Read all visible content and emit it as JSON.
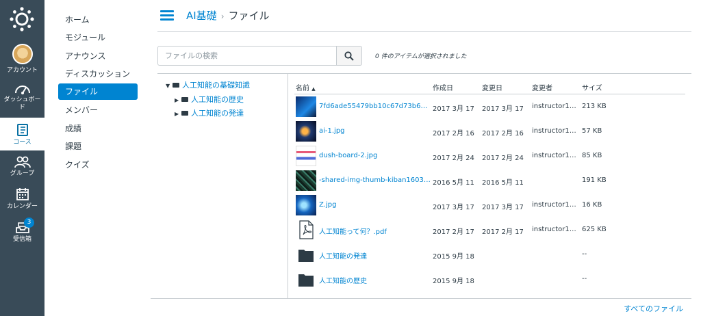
{
  "global_nav": {
    "account": "アカウント",
    "dashboard": "ダッシュボード",
    "courses": "コース",
    "groups": "グループ",
    "calendar": "カレンダー",
    "inbox": "受信箱",
    "inbox_badge": "3"
  },
  "course_nav": {
    "items": [
      "ホーム",
      "モジュール",
      "アナウンス",
      "ディスカッション",
      "ファイル",
      "メンバー",
      "成績",
      "課題",
      "クイズ"
    ],
    "active_index": 4
  },
  "breadcrumb": {
    "course": "AI基礎",
    "page": "ファイル"
  },
  "search": {
    "placeholder": "ファイルの検索"
  },
  "selection_info": "0 件のアイテムが選択されました",
  "tree": {
    "root": "人工知能の基礎知識",
    "children": [
      "人工知能の歴史",
      "人工知能の発達"
    ]
  },
  "table": {
    "headers": {
      "name": "名前",
      "created": "作成日",
      "modified": "変更日",
      "modifier": "変更者",
      "size": "サイズ"
    },
    "rows": [
      {
        "name": "7fd6ade55479bb10c67d73b64c1...",
        "created": "2017 3月 17",
        "modified": "2017 3月 17",
        "modifier": "instructor1@b...",
        "size": "213 KB",
        "icon": "image-thumbnail"
      },
      {
        "name": "ai-1.jpg",
        "created": "2017 2月 16",
        "modified": "2017 2月 16",
        "modifier": "instructor1@b...",
        "size": "57 KB",
        "icon": "image-thumbnail"
      },
      {
        "name": "dush-board-2.jpg",
        "created": "2017 2月 24",
        "modified": "2017 2月 24",
        "modifier": "instructor1@b...",
        "size": "85 KB",
        "icon": "image-thumbnail"
      },
      {
        "name": "-shared-img-thumb-kiban1603093...",
        "created": "2016 5月 11",
        "modified": "2016 5月 11",
        "modifier": "",
        "size": "191 KB",
        "icon": "image-thumbnail"
      },
      {
        "name": "Z.jpg",
        "created": "2017 3月 17",
        "modified": "2017 3月 17",
        "modifier": "instructor1@b...",
        "size": "16 KB",
        "icon": "image-thumbnail"
      },
      {
        "name": "人工知能って何？.pdf",
        "created": "2017 2月 17",
        "modified": "2017 2月 17",
        "modifier": "instructor1@b...",
        "size": "625 KB",
        "icon": "pdf-icon"
      },
      {
        "name": "人工知能の発達",
        "created": "2015 9月 18",
        "modified": "",
        "modifier": "",
        "size": "--",
        "icon": "folder-icon"
      },
      {
        "name": "人工知能の歴史",
        "created": "2015 9月 18",
        "modified": "",
        "modifier": "",
        "size": "--",
        "icon": "folder-icon"
      }
    ]
  },
  "footer_link": "すべてのファイル",
  "colors": {
    "nav_bg": "#394b58",
    "accent": "#0084d1",
    "text": "#2d3b45"
  }
}
